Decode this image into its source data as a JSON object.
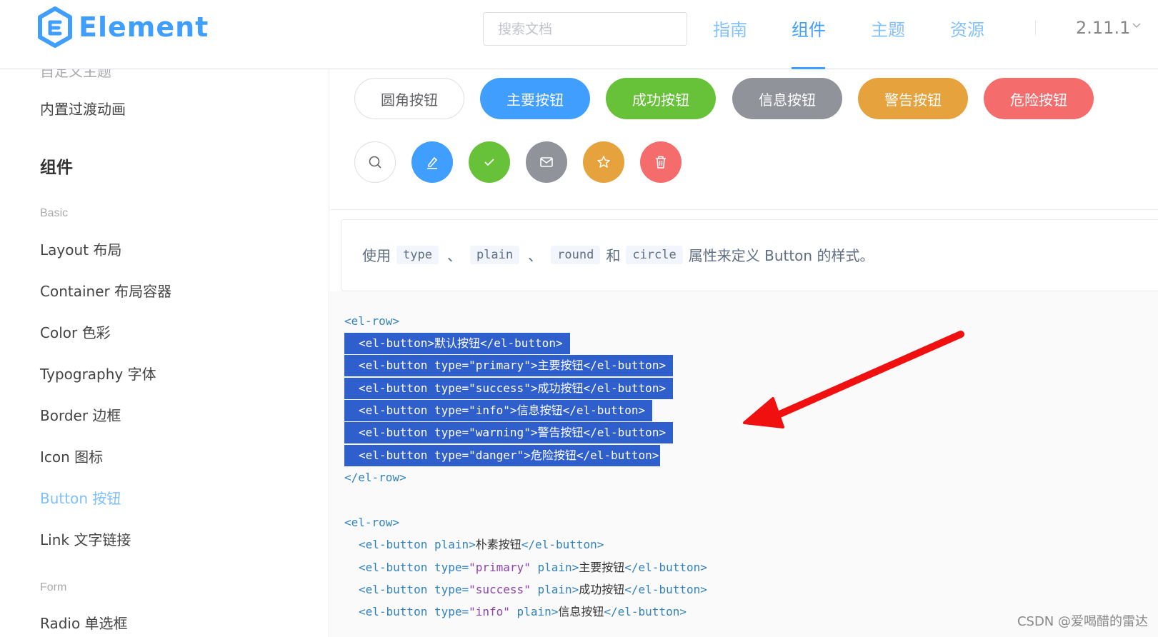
{
  "header": {
    "logo_text": "Element",
    "search_placeholder": "搜索文档",
    "nav": [
      "指南",
      "组件",
      "主题",
      "资源"
    ],
    "active_nav": "组件",
    "version": "2.11.1"
  },
  "sidebar": {
    "cut_item": "自定义主题",
    "transition_item": "内置过渡动画",
    "group": "组件",
    "category_basic": "Basic",
    "items": [
      "Layout 布局",
      "Container 布局容器",
      "Color 色彩",
      "Typography 字体",
      "Border 边框",
      "Icon 图标",
      "Button 按钮",
      "Link 文字链接"
    ],
    "active_item": "Button 按钮",
    "category_form": "Form",
    "cut_bottom_item": "Radio 单选框"
  },
  "demo": {
    "round_buttons": [
      "圆角按钮",
      "主要按钮",
      "成功按钮",
      "信息按钮",
      "警告按钮",
      "危险按钮"
    ],
    "circle_icons": [
      "search-icon",
      "edit-icon",
      "check-icon",
      "message-icon",
      "star-icon",
      "delete-icon"
    ],
    "colors": {
      "default": "#ffffff",
      "primary": "#409EFF",
      "success": "#67C23A",
      "info": "#909399",
      "warning": "#E6A23C",
      "danger": "#F56C6C"
    }
  },
  "description": {
    "prefix": "使用",
    "codes": [
      "type",
      "plain",
      "round",
      "circle"
    ],
    "sep": "、",
    "and": "和",
    "suffix": "属性来定义 Button 的样式。"
  },
  "code": {
    "row_open": "<el-row>",
    "row_close": "</el-row>",
    "block1": [
      {
        "open": "<el-button",
        "attr": "",
        "val": "",
        "rest": ">",
        "text": "默认按钮",
        "close": "</el-button>"
      },
      {
        "open": "<el-button",
        "attr": " type=",
        "val": "\"primary\"",
        "rest": ">",
        "text": "主要按钮",
        "close": "</el-button>"
      },
      {
        "open": "<el-button",
        "attr": " type=",
        "val": "\"success\"",
        "rest": ">",
        "text": "成功按钮",
        "close": "</el-button>"
      },
      {
        "open": "<el-button",
        "attr": " type=",
        "val": "\"info\"",
        "rest": ">",
        "text": "信息按钮",
        "close": "</el-button>"
      },
      {
        "open": "<el-button",
        "attr": " type=",
        "val": "\"warning\"",
        "rest": ">",
        "text": "警告按钮",
        "close": "</el-button>"
      },
      {
        "open": "<el-button",
        "attr": " type=",
        "val": "\"danger\"",
        "rest": ">",
        "text": "危险按钮",
        "close": "</el-button>"
      }
    ],
    "block2": [
      {
        "open": "<el-button",
        "attr": " plain",
        "val": "",
        "rest": ">",
        "text": "朴素按钮",
        "close": "</el-button>"
      },
      {
        "open": "<el-button",
        "attr": " type=",
        "val": "\"primary\"",
        "rest": " plain>",
        "text": "主要按钮",
        "close": "</el-button>"
      },
      {
        "open": "<el-button",
        "attr": " type=",
        "val": "\"success\"",
        "rest": " plain>",
        "text": "成功按钮",
        "close": "</el-button>"
      },
      {
        "open": "<el-button",
        "attr": " type=",
        "val": "\"info\"",
        "rest": " plain>",
        "text": "信息按钮",
        "close": "</el-button>"
      }
    ]
  },
  "watermark": "CSDN @爱喝醋的雷达"
}
